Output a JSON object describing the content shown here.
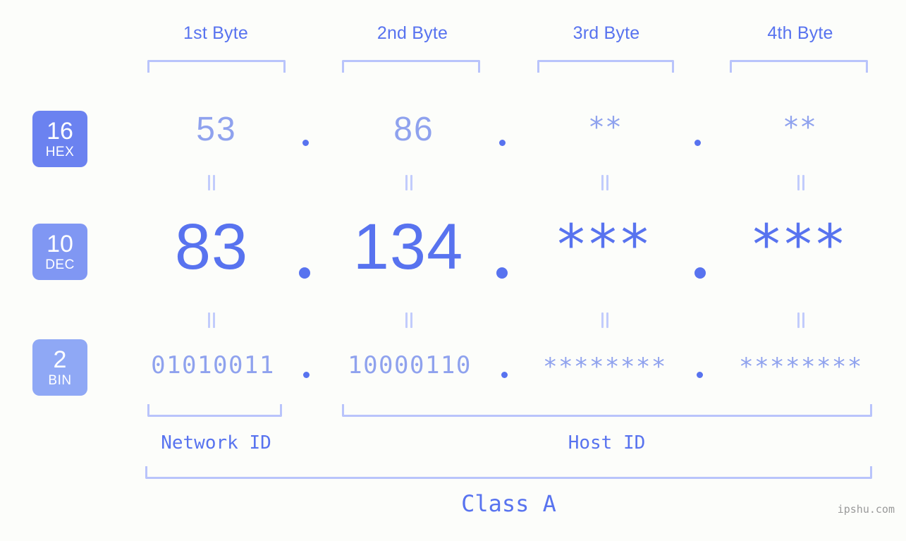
{
  "meta": {
    "background_color": "#fcfdfa",
    "accent_strong": "#5873ef",
    "accent_mid": "#8fa2ee",
    "accent_light": "#b9c4fb",
    "watermark": "ipshu.com"
  },
  "headers": [
    {
      "label": "1st Byte"
    },
    {
      "label": "2nd Byte"
    },
    {
      "label": "3rd Byte"
    },
    {
      "label": "4th Byte"
    }
  ],
  "bases": [
    {
      "num": "16",
      "abbr": "HEX",
      "color": "#6b82f0"
    },
    {
      "num": "10",
      "abbr": "DEC",
      "color": "#8097f3"
    },
    {
      "num": "2",
      "abbr": "BIN",
      "color": "#8fa8f5"
    }
  ],
  "rows": {
    "hex": {
      "values": [
        "53",
        "86",
        "**",
        "**"
      ],
      "known": [
        true,
        true,
        false,
        false
      ]
    },
    "dec": {
      "values": [
        "83",
        "134",
        "***",
        "***"
      ],
      "known": [
        true,
        true,
        false,
        false
      ]
    },
    "bin": {
      "values": [
        "01010011",
        "10000110",
        "********",
        "********"
      ],
      "known": [
        true,
        true,
        false,
        false
      ]
    }
  },
  "separators": {
    "symbol": "."
  },
  "equals": {
    "symbol": "="
  },
  "segments": {
    "network_id": "Network ID",
    "host_id": "Host ID",
    "ip_class": "Class A"
  }
}
